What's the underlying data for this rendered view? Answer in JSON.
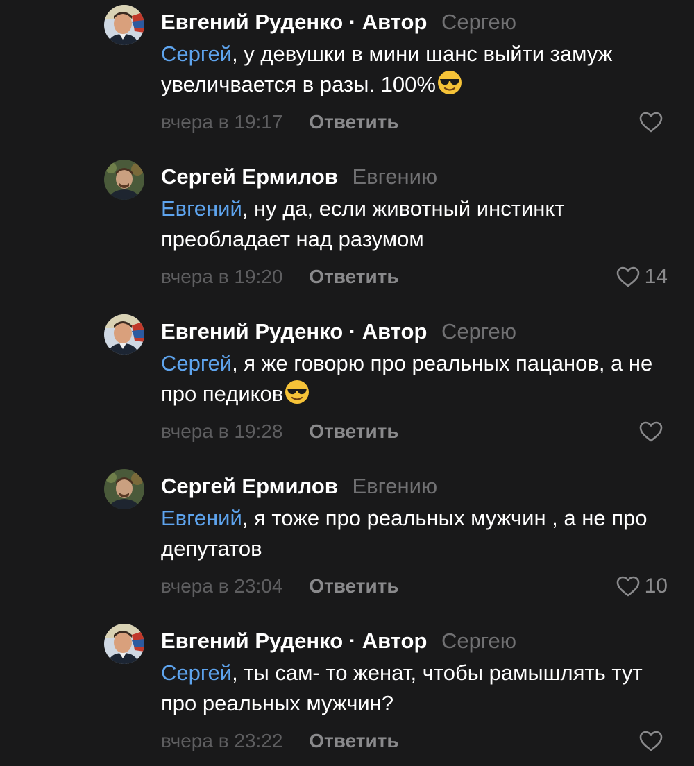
{
  "colors": {
    "background": "#19191a",
    "text": "#ffffff",
    "mention": "#5ea4ee",
    "muted": "#717173",
    "action": "#8a8a8c"
  },
  "comments": [
    {
      "author": "Евгений Руденко",
      "role": "· Автор",
      "reply_to": "Сергею",
      "mention": "Сергей",
      "text": ", у девушки в мини шанс выйти замуж увеличвается в разы. 100%",
      "emoji": "smiling-face-with-sunglasses",
      "time": "вчера в 19:17",
      "reply_label": "Ответить",
      "likes": "",
      "avatar": "avatar-evgeniy-icon"
    },
    {
      "author": "Сергей Ермилов",
      "role": "",
      "reply_to": "Евгению",
      "mention": "Евгений",
      "text": ", ну да, если животный инстинкт преобладает над разумом",
      "emoji": "",
      "time": "вчера в 19:20",
      "reply_label": "Ответить",
      "likes": "14",
      "avatar": "avatar-sergey-icon"
    },
    {
      "author": "Евгений Руденко",
      "role": "· Автор",
      "reply_to": "Сергею",
      "mention": "Сергей",
      "text": ", я же говорю про реальных пацанов, а не про педиков",
      "emoji": "smiling-face-with-sunglasses",
      "time": "вчера в 19:28",
      "reply_label": "Ответить",
      "likes": "",
      "avatar": "avatar-evgeniy-icon"
    },
    {
      "author": "Сергей Ермилов",
      "role": "",
      "reply_to": "Евгению",
      "mention": "Евгений",
      "text": ", я тоже про реальных мужчин , а не про депутатов",
      "emoji": "",
      "time": "вчера в 23:04",
      "reply_label": "Ответить",
      "likes": "10",
      "avatar": "avatar-sergey-icon"
    },
    {
      "author": "Евгений Руденко",
      "role": "· Автор",
      "reply_to": "Сергею",
      "mention": "Сергей",
      "text": ", ты сам- то женат, чтобы рамышлять тут про реальных мужчин?",
      "emoji": "",
      "time": "вчера в 23:22",
      "reply_label": "Ответить",
      "likes": "",
      "avatar": "avatar-evgeniy-icon"
    }
  ]
}
